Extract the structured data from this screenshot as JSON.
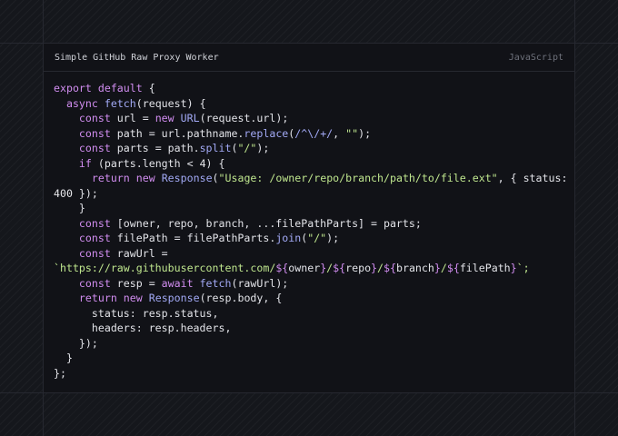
{
  "card": {
    "title": "Simple GitHub Raw Proxy Worker",
    "language": "JavaScript"
  },
  "code_lines": [
    [
      {
        "t": "export default",
        "c": "kw"
      },
      {
        "t": " {",
        "c": "pl"
      }
    ],
    [
      {
        "t": "  ",
        "c": "pl"
      },
      {
        "t": "async",
        "c": "kw"
      },
      {
        "t": " ",
        "c": "pl"
      },
      {
        "t": "fetch",
        "c": "fn"
      },
      {
        "t": "(request) {",
        "c": "pl"
      }
    ],
    [
      {
        "t": "    ",
        "c": "pl"
      },
      {
        "t": "const",
        "c": "kw"
      },
      {
        "t": " url = ",
        "c": "pl"
      },
      {
        "t": "new",
        "c": "kw"
      },
      {
        "t": " ",
        "c": "pl"
      },
      {
        "t": "URL",
        "c": "fn"
      },
      {
        "t": "(request.url);",
        "c": "pl"
      }
    ],
    [
      {
        "t": "    ",
        "c": "pl"
      },
      {
        "t": "const",
        "c": "kw"
      },
      {
        "t": " path = url.pathname.",
        "c": "pl"
      },
      {
        "t": "replace",
        "c": "fn"
      },
      {
        "t": "(",
        "c": "pl"
      },
      {
        "t": "/^\\/+/",
        "c": "fn"
      },
      {
        "t": ", ",
        "c": "pl"
      },
      {
        "t": "\"\"",
        "c": "str"
      },
      {
        "t": ");",
        "c": "pl"
      }
    ],
    [
      {
        "t": "    ",
        "c": "pl"
      },
      {
        "t": "const",
        "c": "kw"
      },
      {
        "t": " parts = path.",
        "c": "pl"
      },
      {
        "t": "split",
        "c": "fn"
      },
      {
        "t": "(",
        "c": "pl"
      },
      {
        "t": "\"/\"",
        "c": "str"
      },
      {
        "t": ");",
        "c": "pl"
      }
    ],
    [
      {
        "t": "    ",
        "c": "pl"
      },
      {
        "t": "if",
        "c": "kw"
      },
      {
        "t": " (parts.length < ",
        "c": "pl"
      },
      {
        "t": "4",
        "c": "num"
      },
      {
        "t": ") {",
        "c": "pl"
      }
    ],
    [
      {
        "t": "      ",
        "c": "pl"
      },
      {
        "t": "return",
        "c": "kw"
      },
      {
        "t": " ",
        "c": "pl"
      },
      {
        "t": "new",
        "c": "kw"
      },
      {
        "t": " ",
        "c": "pl"
      },
      {
        "t": "Response",
        "c": "fn"
      },
      {
        "t": "(",
        "c": "pl"
      },
      {
        "t": "\"Usage: /owner/repo/branch/path/to/file.ext\"",
        "c": "str"
      },
      {
        "t": ", { status:",
        "c": "pl"
      }
    ],
    [
      {
        "t": "400",
        "c": "num"
      },
      {
        "t": " });",
        "c": "pl"
      }
    ],
    [
      {
        "t": "    }",
        "c": "pl"
      }
    ],
    [
      {
        "t": "    ",
        "c": "pl"
      },
      {
        "t": "const",
        "c": "kw"
      },
      {
        "t": " [owner, repo, branch, ...filePathParts] = parts;",
        "c": "pl"
      }
    ],
    [
      {
        "t": "    ",
        "c": "pl"
      },
      {
        "t": "const",
        "c": "kw"
      },
      {
        "t": " filePath = filePathParts.",
        "c": "pl"
      },
      {
        "t": "join",
        "c": "fn"
      },
      {
        "t": "(",
        "c": "pl"
      },
      {
        "t": "\"/\"",
        "c": "str"
      },
      {
        "t": ");",
        "c": "pl"
      }
    ],
    [
      {
        "t": "    ",
        "c": "pl"
      },
      {
        "t": "const",
        "c": "kw"
      },
      {
        "t": " rawUrl =",
        "c": "pl"
      }
    ],
    [
      {
        "t": "`https://raw.githubusercontent.com/",
        "c": "str"
      },
      {
        "t": "${",
        "c": "kw"
      },
      {
        "t": "owner",
        "c": "pl"
      },
      {
        "t": "}",
        "c": "kw"
      },
      {
        "t": "/",
        "c": "str"
      },
      {
        "t": "${",
        "c": "kw"
      },
      {
        "t": "repo",
        "c": "pl"
      },
      {
        "t": "}",
        "c": "kw"
      },
      {
        "t": "/",
        "c": "str"
      },
      {
        "t": "${",
        "c": "kw"
      },
      {
        "t": "branch",
        "c": "pl"
      },
      {
        "t": "}",
        "c": "kw"
      },
      {
        "t": "/",
        "c": "str"
      },
      {
        "t": "${",
        "c": "kw"
      },
      {
        "t": "filePath",
        "c": "pl"
      },
      {
        "t": "}",
        "c": "kw"
      },
      {
        "t": "`;",
        "c": "str"
      }
    ],
    [
      {
        "t": "    ",
        "c": "pl"
      },
      {
        "t": "const",
        "c": "kw"
      },
      {
        "t": " resp = ",
        "c": "pl"
      },
      {
        "t": "await",
        "c": "kw"
      },
      {
        "t": " ",
        "c": "pl"
      },
      {
        "t": "fetch",
        "c": "fn"
      },
      {
        "t": "(rawUrl);",
        "c": "pl"
      }
    ],
    [
      {
        "t": "    ",
        "c": "pl"
      },
      {
        "t": "return",
        "c": "kw"
      },
      {
        "t": " ",
        "c": "pl"
      },
      {
        "t": "new",
        "c": "kw"
      },
      {
        "t": " ",
        "c": "pl"
      },
      {
        "t": "Response",
        "c": "fn"
      },
      {
        "t": "(resp.body, {",
        "c": "pl"
      }
    ],
    [
      {
        "t": "      status: resp.status,",
        "c": "pl"
      }
    ],
    [
      {
        "t": "      headers: resp.headers,",
        "c": "pl"
      }
    ],
    [
      {
        "t": "    });",
        "c": "pl"
      }
    ],
    [
      {
        "t": "  }",
        "c": "pl"
      }
    ],
    [
      {
        "t": "};",
        "c": "pl"
      }
    ]
  ]
}
